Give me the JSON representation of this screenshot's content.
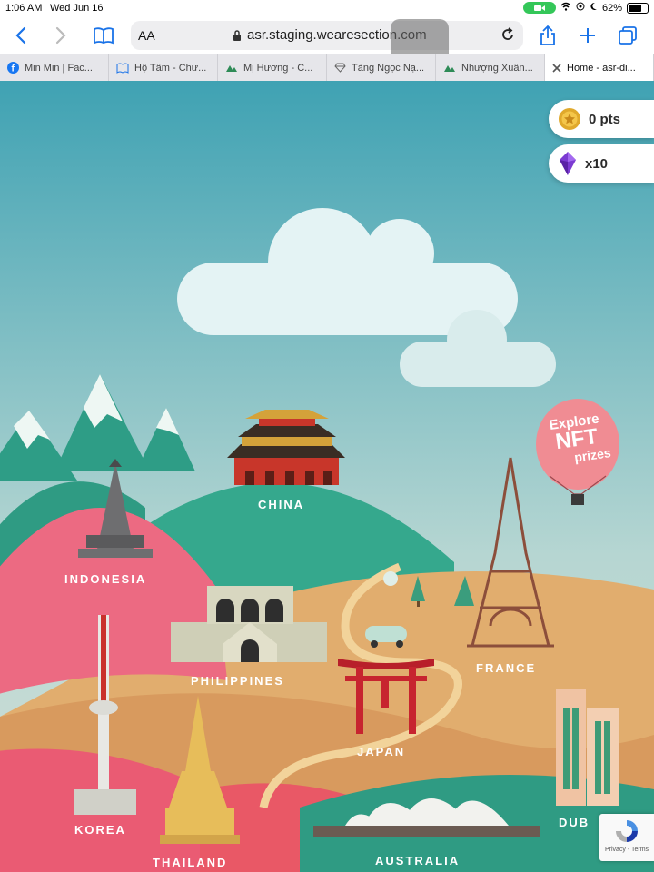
{
  "status": {
    "time": "1:06 AM",
    "date": "Wed Jun 16",
    "battery": "62%"
  },
  "browser": {
    "aa_label": "AA",
    "url": "asr.staging.wearesection.com",
    "tabs": [
      {
        "label": "Min Min | Fac..."
      },
      {
        "label": "Hộ Tâm - Chư..."
      },
      {
        "label": "Mị Hương - C..."
      },
      {
        "label": "Tàng Ngọc Nạ..."
      },
      {
        "label": "Nhượng Xuân..."
      },
      {
        "label": "Home - asr-di..."
      }
    ]
  },
  "hud": {
    "points": "0 pts",
    "gems": "x10"
  },
  "balloon": {
    "line1": "Explore",
    "line2": "NFT",
    "line3": "prizes"
  },
  "regions": {
    "china": "CHINA",
    "indonesia": "INDONESIA",
    "philippines": "PHILIPPINES",
    "france": "FRANCE",
    "japan": "JAPAN",
    "korea": "KOREA",
    "thailand": "THAILAND",
    "australia": "AUSTRALIA",
    "dubai": "DUB"
  },
  "recaptcha": {
    "text": "Privacy - Terms"
  },
  "colors": {
    "sky_top": "#3fa2b3",
    "sky_bottom": "#c9dcd6",
    "sand": "#e1ad6e",
    "pink": "#ec6a82",
    "green": "#37a88a"
  }
}
